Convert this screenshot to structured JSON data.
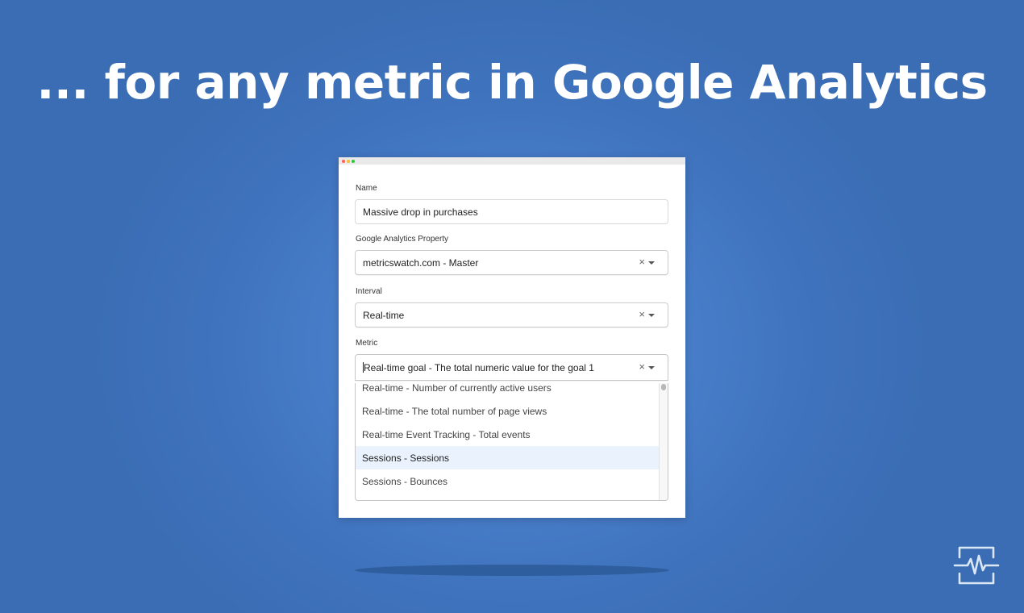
{
  "headline": "... for any metric in Google Analytics",
  "form": {
    "name_label": "Name",
    "name_value": "Massive drop in purchases",
    "property_label": "Google Analytics Property",
    "property_value": "metricswatch.com - Master",
    "interval_label": "Interval",
    "interval_value": "Real-time",
    "metric_label": "Metric",
    "metric_value": "Real-time goal - The total numeric value for the goal 1",
    "clear_glyph": "×"
  },
  "dropdown": {
    "options": [
      {
        "label": "Real-time - Number of currently active users"
      },
      {
        "label": "Real-time - The total number of page views"
      },
      {
        "label": "Real-time Event Tracking - Total events"
      },
      {
        "label": "Sessions - Sessions",
        "highlighted": true
      },
      {
        "label": "Sessions - Bounces"
      }
    ]
  },
  "colors": {
    "background": "#3f73bd",
    "highlight": "#eaf2fd"
  },
  "icons": {
    "brand_logo": "pulse-monitor-icon"
  }
}
